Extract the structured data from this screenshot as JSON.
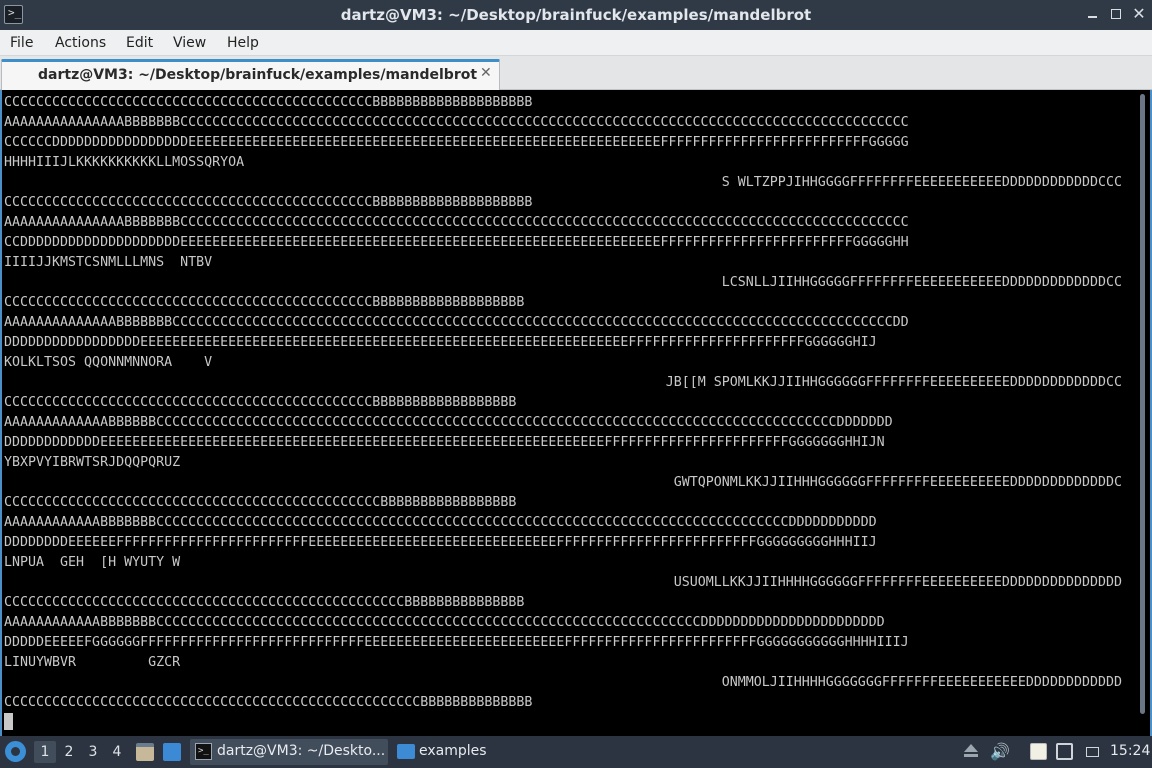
{
  "window": {
    "title": "dartz@VM3: ~/Desktop/brainfuck/examples/mandelbrot",
    "close_glyph": "✕"
  },
  "menu": {
    "items": [
      "File",
      "Actions",
      "Edit",
      "View",
      "Help"
    ]
  },
  "tab": {
    "label": "dartz@VM3: ~/Desktop/brainfuck/examples/mandelbrot",
    "close_glyph": "✕"
  },
  "terminal": {
    "lines": [
      {
        "text": "CCCCCCCCCCCCCCCCCCCCCCCCCCCCCCCCCCCCCCCCCCCCCCBBBBBBBBBBBBBBBBBBBB",
        "align": "left"
      },
      {
        "text": "AAAAAAAAAAAAAAABBBBBBBCCCCCCCCCCCCCCCCCCCCCCCCCCCCCCCCCCCCCCCCCCCCCCCCCCCCCCCCCCCCCCCCCCCCCCCCCCCCCCCCCCCCCCCCCCC",
        "align": "left"
      },
      {
        "text": "CCCCCCDDDDDDDDDDDDDDDDDEEEEEEEEEEEEEEEEEEEEEEEEEEEEEEEEEEEEEEEEEEEEEEEEEEEEEEEEEEEFFFFFFFFFFFFFFFFFFFFFFFFFFGGGGG",
        "align": "left"
      },
      {
        "text": "HHHHIIIJLKKKKKKKKKKLLMOSSQRYOA",
        "align": "left"
      },
      {
        "text": "S WLTZPPJIHHGGGGFFFFFFFFEEEEEEEEEEEDDDDDDDDDDDDCCC",
        "align": "right"
      },
      {
        "text": "CCCCCCCCCCCCCCCCCCCCCCCCCCCCCCCCCCCCCCCCCCCCCCBBBBBBBBBBBBBBBBBBBB",
        "align": "left"
      },
      {
        "text": "AAAAAAAAAAAAAAABBBBBBBCCCCCCCCCCCCCCCCCCCCCCCCCCCCCCCCCCCCCCCCCCCCCCCCCCCCCCCCCCCCCCCCCCCCCCCCCCCCCCCCCCCCCCCCCCC",
        "align": "left"
      },
      {
        "text": "CCDDDDDDDDDDDDDDDDDDDDEEEEEEEEEEEEEEEEEEEEEEEEEEEEEEEEEEEEEEEEEEEEEEEEEEEEEEEEEEEEFFFFFFFFFFFFFFFFFFFFFFFFGGGGGHH",
        "align": "left"
      },
      {
        "text": "IIIIJJKMSTCSNMLLLMNS  NTBV",
        "align": "left"
      },
      {
        "text": "LCSNLLJIIHHGGGGGFFFFFFFFEEEEEEEEEEEDDDDDDDDDDDDDCC",
        "align": "right"
      },
      {
        "text": "CCCCCCCCCCCCCCCCCCCCCCCCCCCCCCCCCCCCCCCCCCCCCCBBBBBBBBBBBBBBBBBBB",
        "align": "left"
      },
      {
        "text": "AAAAAAAAAAAAAABBBBBBBCCCCCCCCCCCCCCCCCCCCCCCCCCCCCCCCCCCCCCCCCCCCCCCCCCCCCCCCCCCCCCCCCCCCCCCCCCCCCCCCCCCCCCCCCCDD",
        "align": "left"
      },
      {
        "text": "DDDDDDDDDDDDDDDDDEEEEEEEEEEEEEEEEEEEEEEEEEEEEEEEEEEEEEEEEEEEEEEEEEEEEEEEEEEEEEFFFFFFFFFFFFFFFFFFFFFFGGGGGGHIJ",
        "align": "left"
      },
      {
        "text": "KOLKLTSOS QQONNMNNORA    V",
        "align": "left"
      },
      {
        "text": "JB[[M SPOMLKKJJIIHHGGGGGGFFFFFFFFEEEEEEEEEEDDDDDDDDDDDDCC",
        "align": "right"
      },
      {
        "text": "CCCCCCCCCCCCCCCCCCCCCCCCCCCCCCCCCCCCCCCCCCCCCCBBBBBBBBBBBBBBBBBB",
        "align": "left"
      },
      {
        "text": "AAAAAAAAAAAAABBBBBBCCCCCCCCCCCCCCCCCCCCCCCCCCCCCCCCCCCCCCCCCCCCCCCCCCCCCCCCCCCCCCCCCCCCCCCCCCCCCCCCCCCCCDDDDDDD",
        "align": "left"
      },
      {
        "text": "DDDDDDDDDDDDEEEEEEEEEEEEEEEEEEEEEEEEEEEEEEEEEEEEEEEEEEEEEEEEEEEEEEEEEEEEEEEFFFFFFFFFFFFFFFFFFFFFFFGGGGGGGHHIJN",
        "align": "left"
      },
      {
        "text": "YBXPVYIBRWTSRJDQQPQRUZ",
        "align": "left"
      },
      {
        "text": "GWTQPONMLKKJJIIHHHGGGGGGFFFFFFFFEEEEEEEEEEDDDDDDDDDDDDDC",
        "align": "right"
      },
      {
        "text": "CCCCCCCCCCCCCCCCCCCCCCCCCCCCCCCCCCCCCCCCCCCCCCCBBBBBBBBBBBBBBBBB",
        "align": "left"
      },
      {
        "text": "AAAAAAAAAAAABBBBBBBCCCCCCCCCCCCCCCCCCCCCCCCCCCCCCCCCCCCCCCCCCCCCCCCCCCCCCCCCCCCCCCCCCCCCCCCCCCCCCCDDDDDDDDDDD",
        "align": "left"
      },
      {
        "text": "DDDDDDDDEEEEEEFFFFFFFFFFFFFFFFFFFFFFFFEEEEEEEEEEEEEEEEEEEEEEEEEEEEEEEFFFFFFFFFFFFFFFFFFFFFFFFFGGGGGGGGGHHHIIJ",
        "align": "left"
      },
      {
        "text": "LNPUA  GEH  [H WYUTY W",
        "align": "left"
      },
      {
        "text": "USUOMLLKKJJIIHHHHGGGGGGFFFFFFFFEEEEEEEEEEDDDDDDDDDDDDDDD",
        "align": "right"
      },
      {
        "text": "CCCCCCCCCCCCCCCCCCCCCCCCCCCCCCCCCCCCCCCCCCCCCCCCCCBBBBBBBBBBBBBBB",
        "align": "left"
      },
      {
        "text": "AAAAAAAAAAAABBBBBBBCCCCCCCCCCCCCCCCCCCCCCCCCCCCCCCCCCCCCCCCCCCCCCCCCCCCCCCCCCCCCCCCCCCCDDDDDDDDDDDDDDDDDDDDDDD",
        "align": "left"
      },
      {
        "text": "DDDDDEEEEEFGGGGGGFFFFFFFFFFFFFFFFFFFFFFFFFFFFEEEEEEEEEEEEEEEEEEEEEEEEEFFFFFFFFFFFFFFFFFFFFFFFFGGGGGGGGGGGHHHHIIIJ",
        "align": "left"
      },
      {
        "text": "LINUYWBVR         GZCR",
        "align": "left"
      },
      {
        "text": "ONMMOLJIIHHHHGGGGGGGFFFFFFFEEEEEEEEEEEDDDDDDDDDDDD",
        "align": "right"
      },
      {
        "text": "CCCCCCCCCCCCCCCCCCCCCCCCCCCCCCCCCCCCCCCCCCCCCCCCCCCCBBBBBBBBBBBBBB",
        "align": "left"
      }
    ]
  },
  "taskbar": {
    "workspaces": [
      "1",
      "2",
      "3",
      "4"
    ],
    "tasks": [
      {
        "label": "dartz@VM3: ~/Deskto..."
      },
      {
        "label": "examples"
      }
    ],
    "clock": "15:24"
  }
}
